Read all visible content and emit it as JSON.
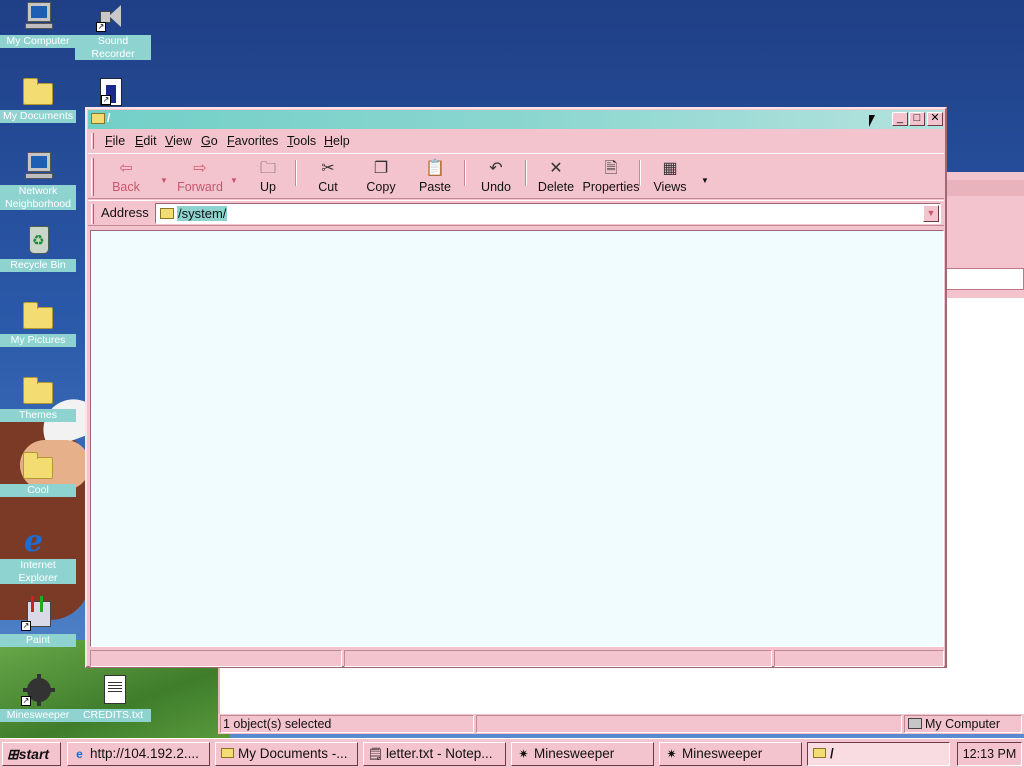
{
  "desktop": {
    "icons": [
      {
        "label": "My Computer"
      },
      {
        "label": "Sound Recorder"
      },
      {
        "label": "My Documents"
      },
      {
        "label": "Network Neighborhood"
      },
      {
        "label": "Recycle Bin"
      },
      {
        "label": "My Pictures"
      },
      {
        "label": "Themes"
      },
      {
        "label": "Cool"
      },
      {
        "label": "Internet Explorer"
      },
      {
        "label": "Paint"
      },
      {
        "label": "Minesweeper"
      },
      {
        "label": "CREDITS.txt"
      }
    ]
  },
  "window": {
    "title": "/",
    "menu": [
      "File",
      "Edit",
      "View",
      "Go",
      "Favorites",
      "Tools",
      "Help"
    ],
    "toolbar": {
      "back": "Back",
      "forward": "Forward",
      "up": "Up",
      "cut": "Cut",
      "copy": "Copy",
      "paste": "Paste",
      "undo": "Undo",
      "delete": "Delete",
      "properties": "Properties",
      "views": "Views"
    },
    "address": {
      "label": "Address",
      "value": "/system/"
    }
  },
  "behind_window": {
    "status": {
      "selection": "1 object(s) selected",
      "zone": "My Computer"
    }
  },
  "taskbar": {
    "start": "start",
    "tasks": [
      {
        "label": "http://104.192.2...."
      },
      {
        "label": "My Documents -..."
      },
      {
        "label": "letter.txt - Notep..."
      },
      {
        "label": "Minesweeper"
      },
      {
        "label": "Minesweeper"
      },
      {
        "label": "/"
      }
    ],
    "clock": "12:13 PM"
  },
  "colors": {
    "window_bg": "#f4c4ce",
    "titlebar": "#72d0c8",
    "content_bg": "#f0fcff",
    "desktop": "#2a58a8"
  }
}
